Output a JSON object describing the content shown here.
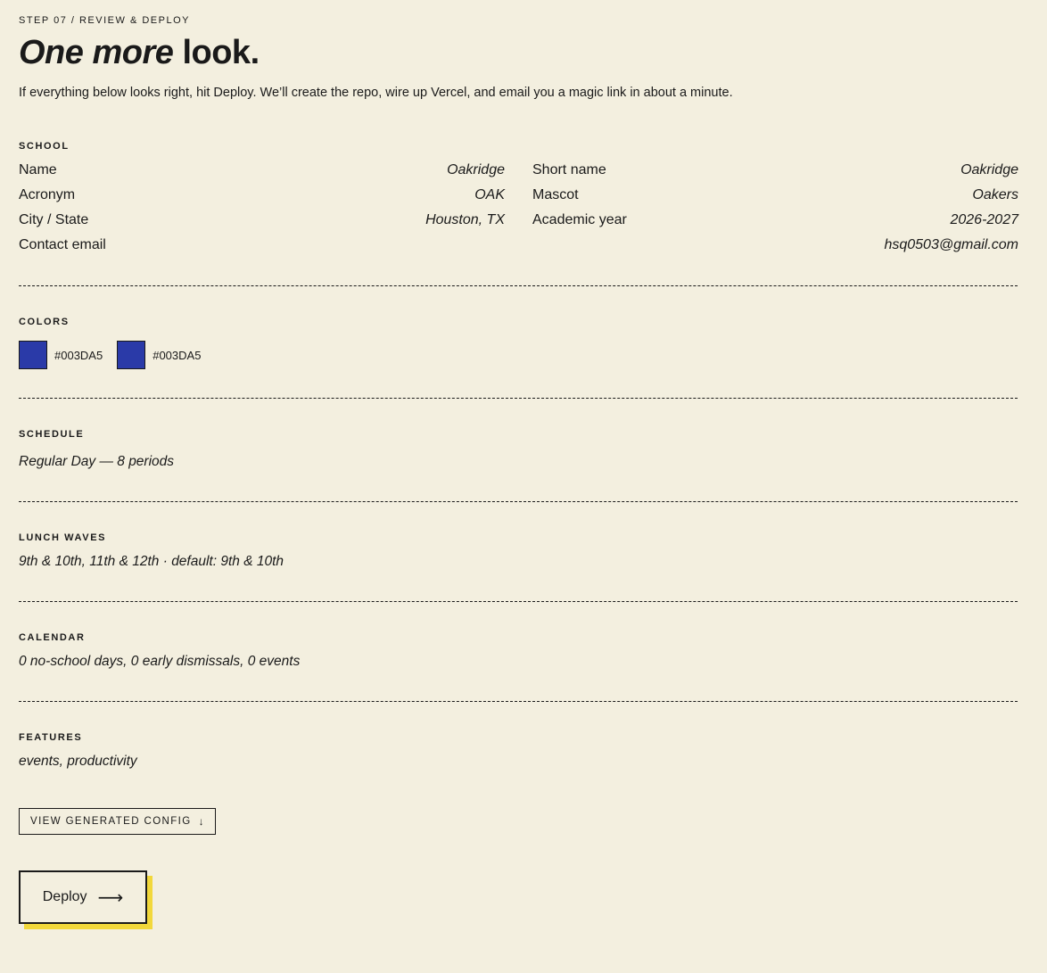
{
  "header": {
    "eyebrow": "STEP 07 / REVIEW & DEPLOY",
    "title_em": "One more",
    "title_rest": " look.",
    "lede": "If everything below looks right, hit Deploy. We’ll create the repo, wire up Vercel, and email you a magic link in about a minute."
  },
  "school": {
    "label": "SCHOOL",
    "rows": [
      {
        "key": "Name",
        "value": "Oakridge"
      },
      {
        "key": "Short name",
        "value": "Oakridge"
      },
      {
        "key": "Acronym",
        "value": "OAK"
      },
      {
        "key": "Mascot",
        "value": "Oakers"
      },
      {
        "key": "City / State",
        "value": "Houston, TX"
      },
      {
        "key": "Academic year",
        "value": "2026-2027"
      },
      {
        "key": "Contact email",
        "value": "hsq0503@gmail.com"
      }
    ]
  },
  "colors": {
    "label": "COLORS",
    "swatches": [
      {
        "hex": "#003DA5",
        "label": "#003DA5"
      },
      {
        "hex": "#003DA5",
        "label": "#003DA5"
      }
    ]
  },
  "schedule": {
    "label": "SCHEDULE",
    "text": "Regular Day — 8 periods"
  },
  "lunch": {
    "label": "LUNCH WAVES",
    "text": "9th & 10th, 11th & 12th · default: 9th & 10th"
  },
  "calendar": {
    "label": "CALENDAR",
    "text": "0 no-school days, 0 early dismissals, 0 events"
  },
  "features": {
    "label": "FEATURES",
    "text": "events, productivity"
  },
  "actions": {
    "config_label": "VIEW GENERATED CONFIG",
    "config_arrow": "↓",
    "deploy_label": "Deploy",
    "deploy_arrow": "⟶"
  },
  "theme": {
    "background": "#f3efdf",
    "ink": "#1a1a1a",
    "accent_shadow": "#f2d83b",
    "swatch_display": "#2a3aa8"
  }
}
